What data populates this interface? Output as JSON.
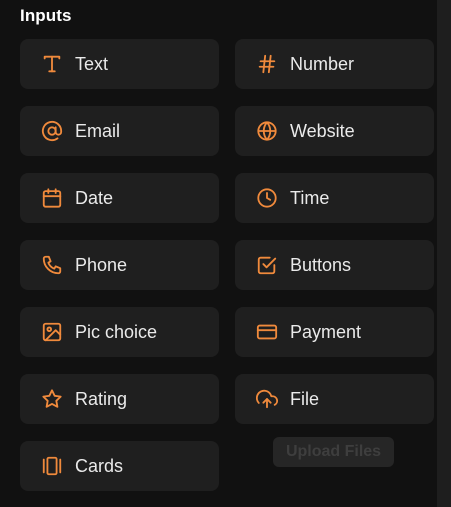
{
  "section": {
    "title": "Inputs"
  },
  "accent_color": "#f08a3c",
  "inputs": [
    {
      "label": "Text",
      "icon": "text-icon"
    },
    {
      "label": "Number",
      "icon": "hash-icon"
    },
    {
      "label": "Email",
      "icon": "at-sign-icon"
    },
    {
      "label": "Website",
      "icon": "globe-icon"
    },
    {
      "label": "Date",
      "icon": "calendar-icon"
    },
    {
      "label": "Time",
      "icon": "clock-icon"
    },
    {
      "label": "Phone",
      "icon": "phone-icon"
    },
    {
      "label": "Buttons",
      "icon": "checkbox-icon"
    },
    {
      "label": "Pic choice",
      "icon": "image-icon"
    },
    {
      "label": "Payment",
      "icon": "credit-card-icon"
    },
    {
      "label": "Rating",
      "icon": "star-icon"
    },
    {
      "label": "File",
      "icon": "cloud-upload-icon"
    },
    {
      "label": "Cards",
      "icon": "cards-icon"
    }
  ],
  "upload_button": {
    "label": "Upload Files"
  }
}
